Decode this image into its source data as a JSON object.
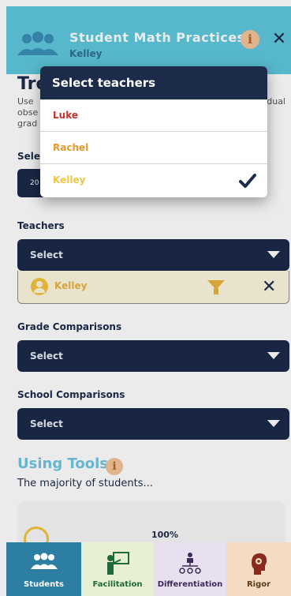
{
  "header": {
    "title": "Student Math Practices",
    "subtitle": "Kelley",
    "info_label": "i",
    "close_label": "✕"
  },
  "page": {
    "title_visible": "Tre",
    "intro_line1": "Use",
    "intro_line1_right": "dual",
    "intro_line2": "obse",
    "intro_line3": "grad",
    "select_label_visible": "Sele",
    "small_select_value": "20"
  },
  "teachers": {
    "label": "Teachers",
    "select_placeholder": "Select",
    "selected_chip": {
      "name": "Kelley"
    }
  },
  "grade_comparisons": {
    "label": "Grade Comparisons",
    "select_placeholder": "Select"
  },
  "school_comparisons": {
    "label": "School Comparisons",
    "select_placeholder": "Select"
  },
  "tools": {
    "title": "Using Tools",
    "info_label": "i",
    "subtitle": "The majority of students...",
    "card_percent": "100%"
  },
  "modal": {
    "title": "Select teachers",
    "options": [
      {
        "name": "Luke",
        "color": "#c4302b",
        "checked": false
      },
      {
        "name": "Rachel",
        "color": "#e59a2e",
        "checked": false
      },
      {
        "name": "Kelley",
        "color": "#f2c53d",
        "checked": true
      }
    ]
  },
  "bottom_nav": [
    {
      "label": "Students",
      "icon": "people-icon",
      "active": true
    },
    {
      "label": "Facilitation",
      "icon": "teacher-board-icon",
      "active": false
    },
    {
      "label": "Differentiation",
      "icon": "hierarchy-icon",
      "active": false
    },
    {
      "label": "Rigor",
      "icon": "head-gear-icon",
      "active": false
    }
  ],
  "colors": {
    "header_bg": "#5ec8dc",
    "navy": "#1d2b4a",
    "accent_yellow": "#f2c53d"
  }
}
